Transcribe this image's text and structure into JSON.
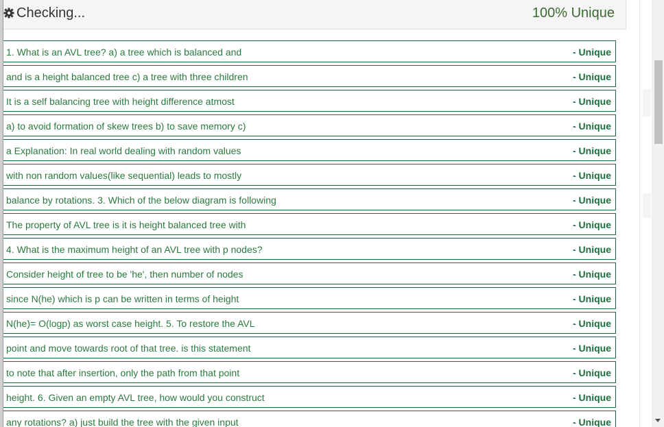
{
  "header": {
    "gear_icon": "gear-icon",
    "title": "Checking...",
    "score": "100% Unique"
  },
  "colors": {
    "row_border": "#1d6e3e",
    "row_text": "#2b7a3d",
    "score_text": "#3a6b2f",
    "header_bg": "#f5f5f5"
  },
  "results": [
    {
      "text": "1. What is an AVL tree? a) a tree which is balanced and",
      "status": "- Unique"
    },
    {
      "text": "and is a height balanced tree c) a tree with three children",
      "status": "- Unique"
    },
    {
      "text": "It is a self balancing tree with height difference atmost",
      "status": "- Unique"
    },
    {
      "text": "a) to avoid formation of skew trees b) to save memory c)",
      "status": "- Unique"
    },
    {
      "text": "a Explanation: In real world dealing with random values",
      "status": "- Unique"
    },
    {
      "text": "with non random values(like sequential) leads to mostly",
      "status": "- Unique"
    },
    {
      "text": "balance by rotations. 3. Which of the below diagram is following",
      "status": "- Unique"
    },
    {
      "text": "The property of AVL tree is it is height balanced tree with",
      "status": "- Unique"
    },
    {
      "text": "4. What is the maximum height of an AVL tree with p nodes?",
      "status": "- Unique"
    },
    {
      "text": "Consider height of tree to be 'he', then number of nodes",
      "status": "- Unique"
    },
    {
      "text": "since N(he) which is p can be written in terms of height",
      "status": "- Unique"
    },
    {
      "text": "N(he)= O(logp) as worst case height. 5. To restore the AVL",
      "status": "- Unique"
    },
    {
      "text": "point and move towards root of that tree. is this statement",
      "status": "- Unique"
    },
    {
      "text": "to note that after insertion, only the path from that point",
      "status": "- Unique"
    },
    {
      "text": "height. 6. Given an empty AVL tree, how would you construct",
      "status": "- Unique"
    },
    {
      "text": "any rotations? a) just build the tree with the given input",
      "status": "- Unique"
    }
  ]
}
